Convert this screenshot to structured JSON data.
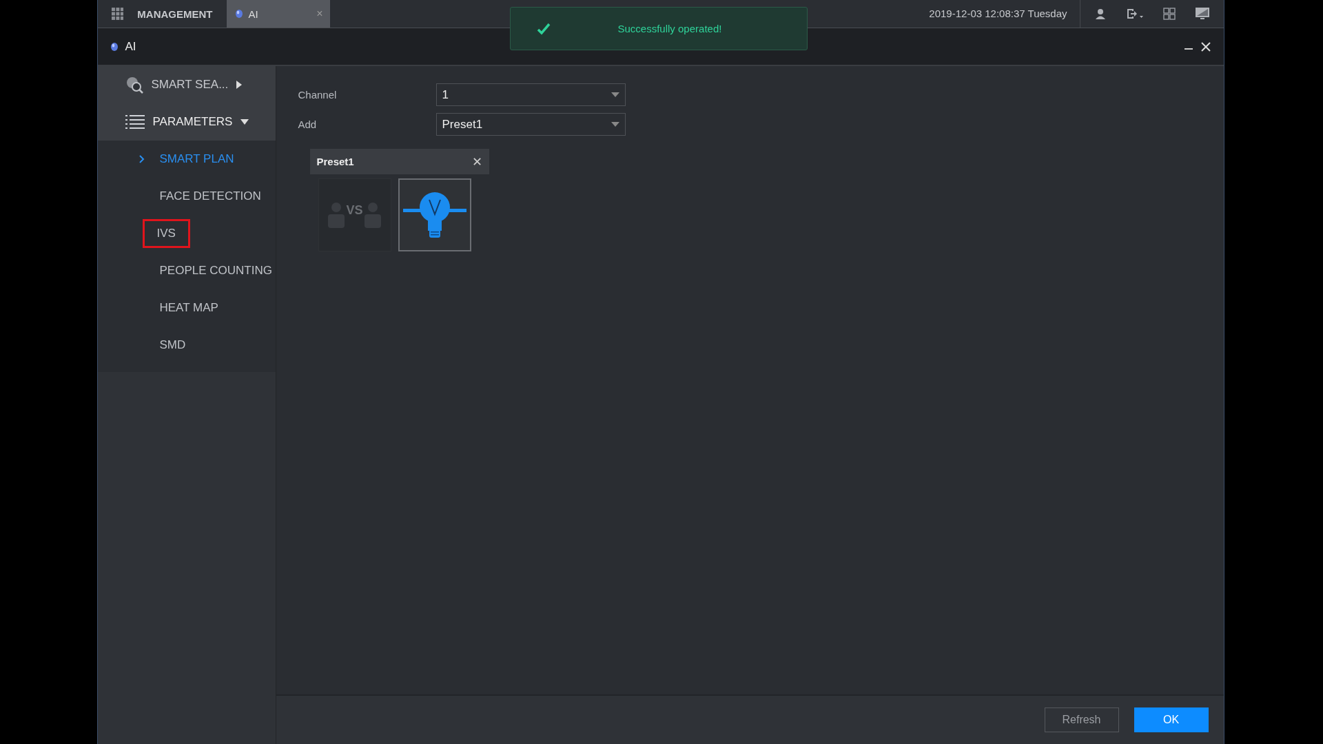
{
  "top_bar": {
    "menu_label": "MANAGEMENT",
    "tabs": [
      {
        "label": "AI",
        "close": "×",
        "selected": true
      }
    ],
    "datetime": "2019-12-03 12:08:37 Tuesday"
  },
  "toast": {
    "message": "Successfully operated!"
  },
  "window": {
    "title": "AI"
  },
  "sidebar": {
    "items": [
      {
        "kind": "search",
        "label": "SMART SEA...",
        "expanded": false
      },
      {
        "kind": "list",
        "label": "PARAMETERS",
        "expanded": true,
        "children": [
          {
            "label": "SMART PLAN",
            "selected": true,
            "highlighted": false
          },
          {
            "label": "FACE DETECTION",
            "selected": false,
            "highlighted": false
          },
          {
            "label": "IVS",
            "selected": false,
            "highlighted": true
          },
          {
            "label": "PEOPLE COUNTING",
            "selected": false,
            "highlighted": false
          },
          {
            "label": "HEAT MAP",
            "selected": false,
            "highlighted": false
          },
          {
            "label": "SMD",
            "selected": false,
            "highlighted": false
          }
        ]
      }
    ]
  },
  "form": {
    "fields": [
      {
        "label": "Channel",
        "value": "1"
      },
      {
        "label": "Add",
        "value": "Preset1"
      }
    ]
  },
  "preset": {
    "title": "Preset1",
    "close": "✕",
    "plans": [
      {
        "kind": "face-compare",
        "selected": false,
        "vs_label": "VS"
      },
      {
        "kind": "ivs",
        "selected": true
      }
    ]
  },
  "buttons": [
    {
      "label": "Refresh",
      "kind": "secondary"
    },
    {
      "label": "OK",
      "kind": "primary"
    }
  ]
}
